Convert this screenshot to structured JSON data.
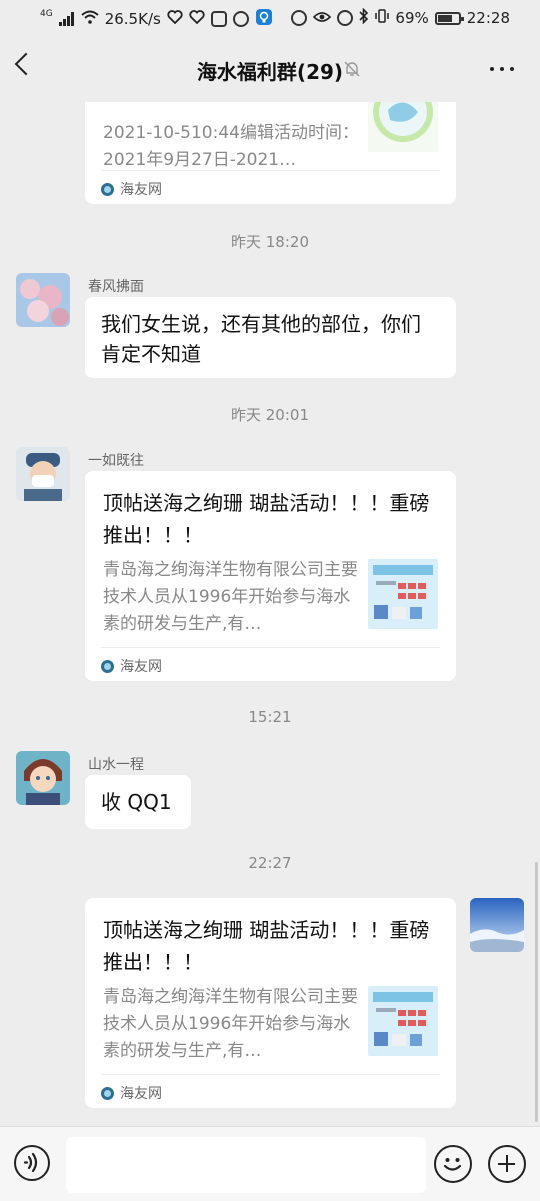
{
  "status_bar": {
    "network_type": "4G",
    "speed": "26.5K/s",
    "battery": "69%",
    "time": "22:28"
  },
  "header": {
    "title": "海水福利群(29)"
  },
  "messages": [
    {
      "type": "link",
      "desc": "2021-10-510:44编辑活动时间：2021年9月27日-2021…",
      "source": "海友网"
    },
    {
      "type": "timestamp",
      "text": "昨天 18:20"
    },
    {
      "type": "text",
      "sender": "春风拂面",
      "text": "我们女生说，还有其他的部位，你们肯定不知道"
    },
    {
      "type": "timestamp",
      "text": "昨天 20:01"
    },
    {
      "type": "link",
      "sender": "一如既往",
      "title": "顶帖送海之绚珊 瑚盐活动！！！重磅推出！！！",
      "desc": "青岛海之绚海洋生物有限公司主要技术人员从1996年开始参与海水素的研发与生产,有…",
      "source": "海友网"
    },
    {
      "type": "timestamp",
      "text": "15:21"
    },
    {
      "type": "text",
      "sender": "山水一程",
      "text": "收 QQ1"
    },
    {
      "type": "timestamp",
      "text": "22:27"
    },
    {
      "type": "link",
      "own": true,
      "title": "顶帖送海之绚珊 瑚盐活动！！！重磅推出！！！",
      "desc": "青岛海之绚海洋生物有限公司主要技术人员从1996年开始参与海水素的研发与生产,有…",
      "source": "海友网"
    }
  ],
  "icons": {
    "back": "chevron-left-icon",
    "mute": "bell-off-icon",
    "more": "more-horizontal-icon",
    "voice": "voice-icon",
    "emoji": "emoji-icon",
    "plus": "plus-icon"
  },
  "colors": {
    "background": "#ededed",
    "bubble": "#ffffff",
    "meta_text": "#888888"
  }
}
